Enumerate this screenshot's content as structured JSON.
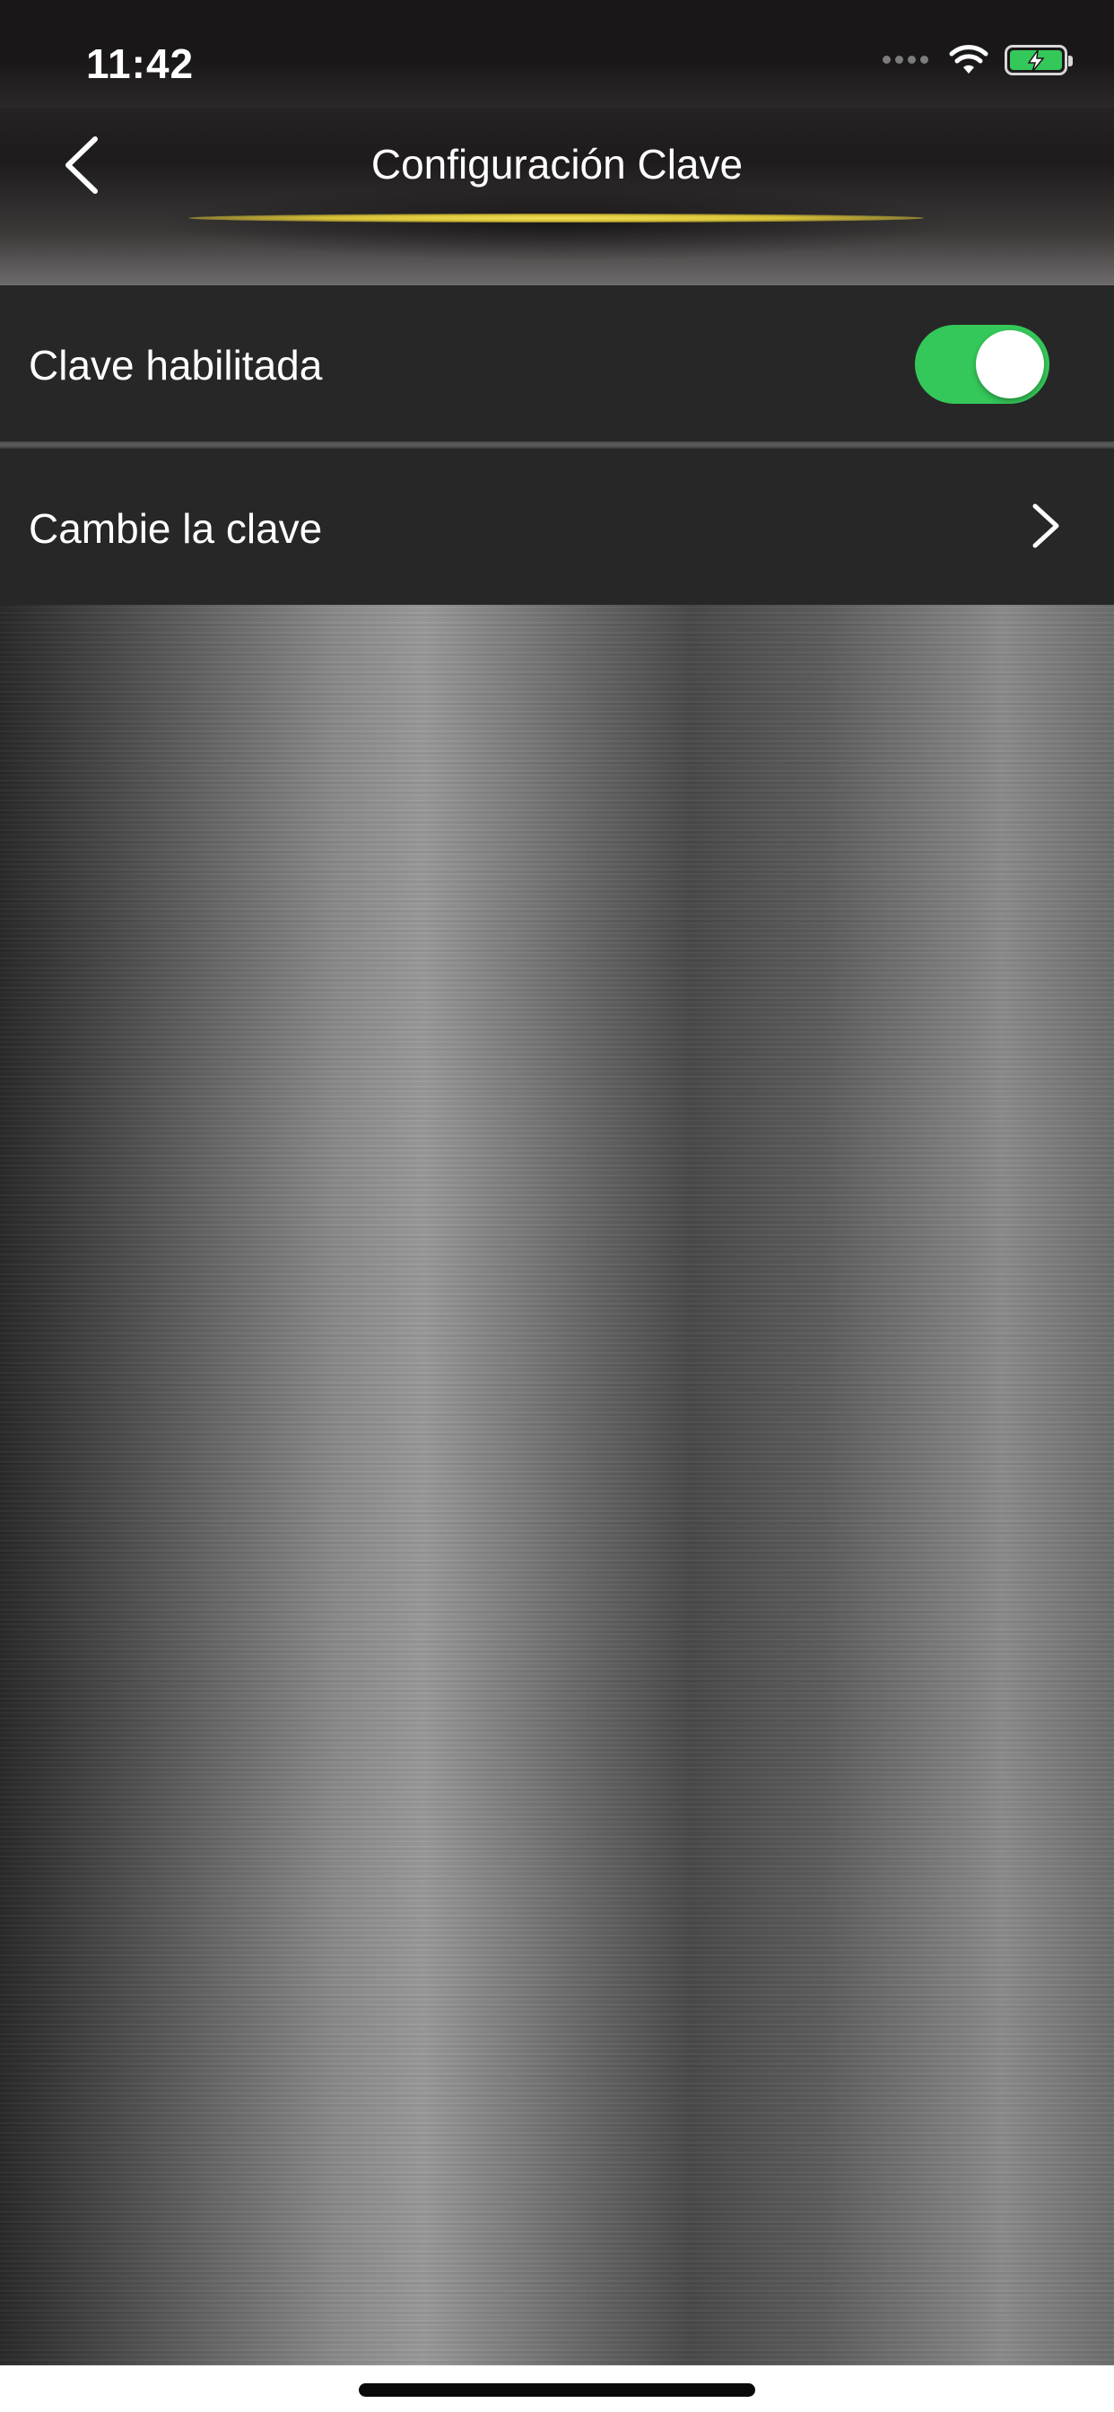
{
  "status_bar": {
    "time": "11:42",
    "icons": [
      "signal-dots-icon",
      "wifi-icon",
      "battery-charging-icon"
    ],
    "battery_color": "#34c759"
  },
  "nav": {
    "title": "Configuración Clave",
    "back_icon": "chevron-left-icon",
    "accent_color": "#e6d24a"
  },
  "settings": {
    "password_enabled": {
      "label": "Clave habilitada",
      "toggle_on": true,
      "toggle_color": "#34c759"
    },
    "change_password": {
      "label": "Cambie la clave",
      "icon": "chevron-right-icon"
    }
  }
}
